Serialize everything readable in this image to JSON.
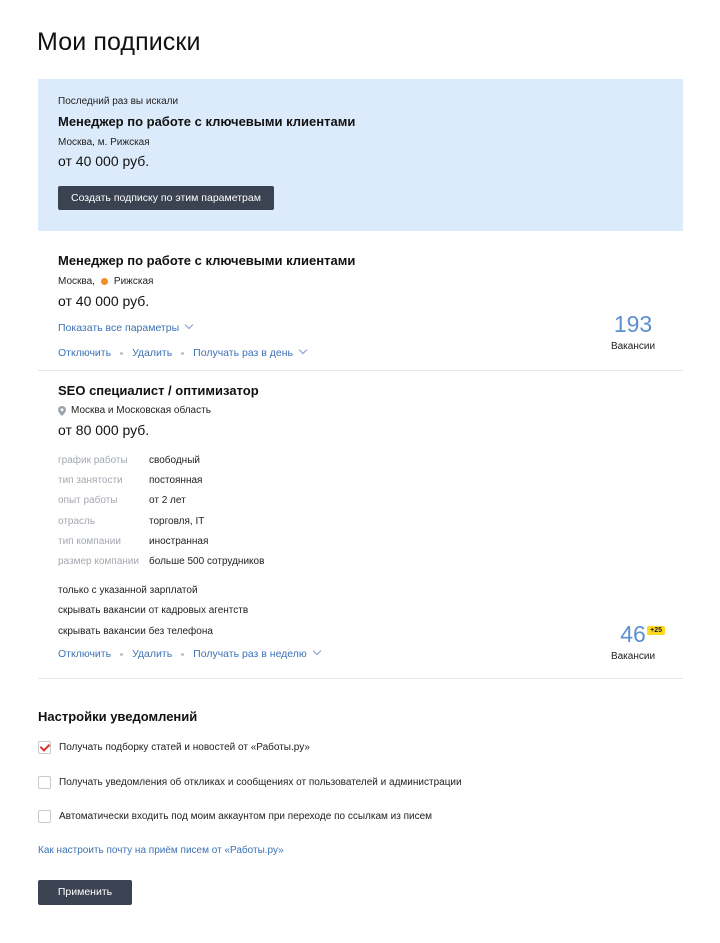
{
  "page": {
    "title": "Мои подписки"
  },
  "last_search": {
    "caption": "Последний раз вы искали",
    "title": "Менеджер по работе с ключевыми клиентами",
    "location": "Москва, м. Рижская",
    "salary": "от 40 000 руб.",
    "create_button": "Создать подписку по этим параметрам"
  },
  "subscriptions": [
    {
      "title": "Менеджер по работе с ключевыми клиентами",
      "city": "Москва,",
      "metro": "Рижская",
      "salary": "от 40 000 руб.",
      "show_params": "Показать все параметры",
      "disable": "Отключить",
      "delete": "Удалить",
      "frequency": "Получать раз в день",
      "count": "193",
      "count_label": "Вакансии"
    },
    {
      "title": "SEO специалист / оптимизатор",
      "region": "Москва и Московская область",
      "salary": "от 80 000 руб.",
      "params": [
        {
          "key": "график работы",
          "value": "свободный"
        },
        {
          "key": "тип занятости",
          "value": "постоянная"
        },
        {
          "key": "опыт работы",
          "value": "от 2 лет"
        },
        {
          "key": "отрасль",
          "value": "торговля, IT"
        },
        {
          "key": "тип компании",
          "value": "иностранная"
        },
        {
          "key": "размер компании",
          "value": "больше 500 сотрудников"
        }
      ],
      "flags": [
        "только с указанной зарплатой",
        "скрывать вакансии от кадровых агентств",
        "скрывать вакансии без телефона"
      ],
      "disable": "Отключить",
      "delete": "Удалить",
      "frequency": "Получать раз в неделю",
      "count": "46",
      "new_badge": "+25",
      "count_label": "Вакансии"
    }
  ],
  "notifications": {
    "title": "Настройки уведомлений",
    "options": [
      {
        "label": "Получать подборку статей и новостей от «Работы.ру»",
        "checked": true
      },
      {
        "label": "Получать уведомления об откликах и сообщениях от пользователей и администрации",
        "checked": false
      },
      {
        "label": "Автоматически входить под моим аккаунтом при переходе по ссылкам из писем",
        "checked": false
      }
    ],
    "mail_link": "Как настроить почту на приём писем от «Работы.ру»",
    "apply_button": "Применить"
  },
  "colors": {
    "accent_link": "#3d72b5",
    "banner_bg": "#dcebfb",
    "button_dark": "#3b4352",
    "metro_orange": "#f28b2b",
    "badge_yellow": "#ffd81f",
    "count_blue": "#5e8fcf"
  }
}
